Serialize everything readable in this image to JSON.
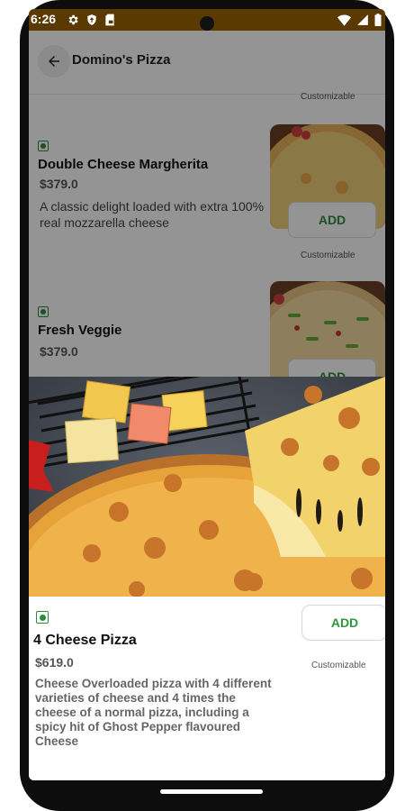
{
  "status_bar": {
    "time": "6:26",
    "left_icons": [
      "gear-icon",
      "shield-icon",
      "sim-card-icon"
    ],
    "right_icons": [
      "wifi-icon",
      "signal-icon",
      "battery-icon"
    ],
    "color": "#5a3a00"
  },
  "header": {
    "title": "Domino's Pizza",
    "back_icon": "arrow-left-icon"
  },
  "menu": {
    "top_customizable": "Customizable",
    "items": [
      {
        "name": "Double Cheese Margherita",
        "price": "$379.0",
        "description": "A classic delight loaded with extra 100% real mozzarella cheese",
        "add_label": "ADD",
        "customizable": "Customizable",
        "veg": true
      },
      {
        "name": "Fresh Veggie",
        "price": "$379.0",
        "add_label": "ADD",
        "veg": true
      }
    ]
  },
  "sheet": {
    "name": "4 Cheese Pizza",
    "price": "$619.0",
    "description": "Cheese Overloaded pizza with 4 different varieties of cheese and 4 times the cheese of a normal pizza, including a spicy hit of Ghost Pepper flavoured Cheese",
    "add_label": "ADD",
    "customizable": "Customizable",
    "veg": true
  },
  "colors": {
    "accent_green": "#2b9a3e",
    "overlay": "rgba(0,0,0,0.42)"
  }
}
